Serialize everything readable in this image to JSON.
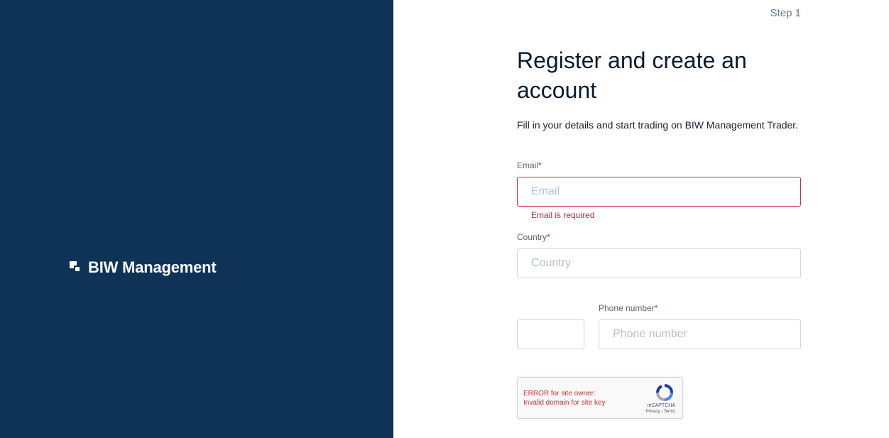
{
  "brand": {
    "name": "BIW Management",
    "left_bg": "#0f3357"
  },
  "step": {
    "label": "Step 1"
  },
  "form": {
    "title": "Register and create an account",
    "subtitle": "Fill in your details and start trading on BIW Management Trader.",
    "email": {
      "label": "Email",
      "required_mark": "*",
      "placeholder": "Email",
      "value": "",
      "error": "Email is required"
    },
    "country": {
      "label": "Country",
      "required_mark": "*",
      "placeholder": "Country",
      "value": ""
    },
    "phone_code": {
      "value": ""
    },
    "phone": {
      "label": "Phone number",
      "required_mark": "*",
      "placeholder": "Phone number",
      "value": ""
    }
  },
  "captcha": {
    "error_line1": "ERROR for site owner:",
    "error_line2": "Invalid domain for site key",
    "brand": "reCAPTCHA",
    "links": "Privacy - Terms"
  },
  "colors": {
    "accent_error": "#c4264b",
    "panel": "#0f3357"
  }
}
